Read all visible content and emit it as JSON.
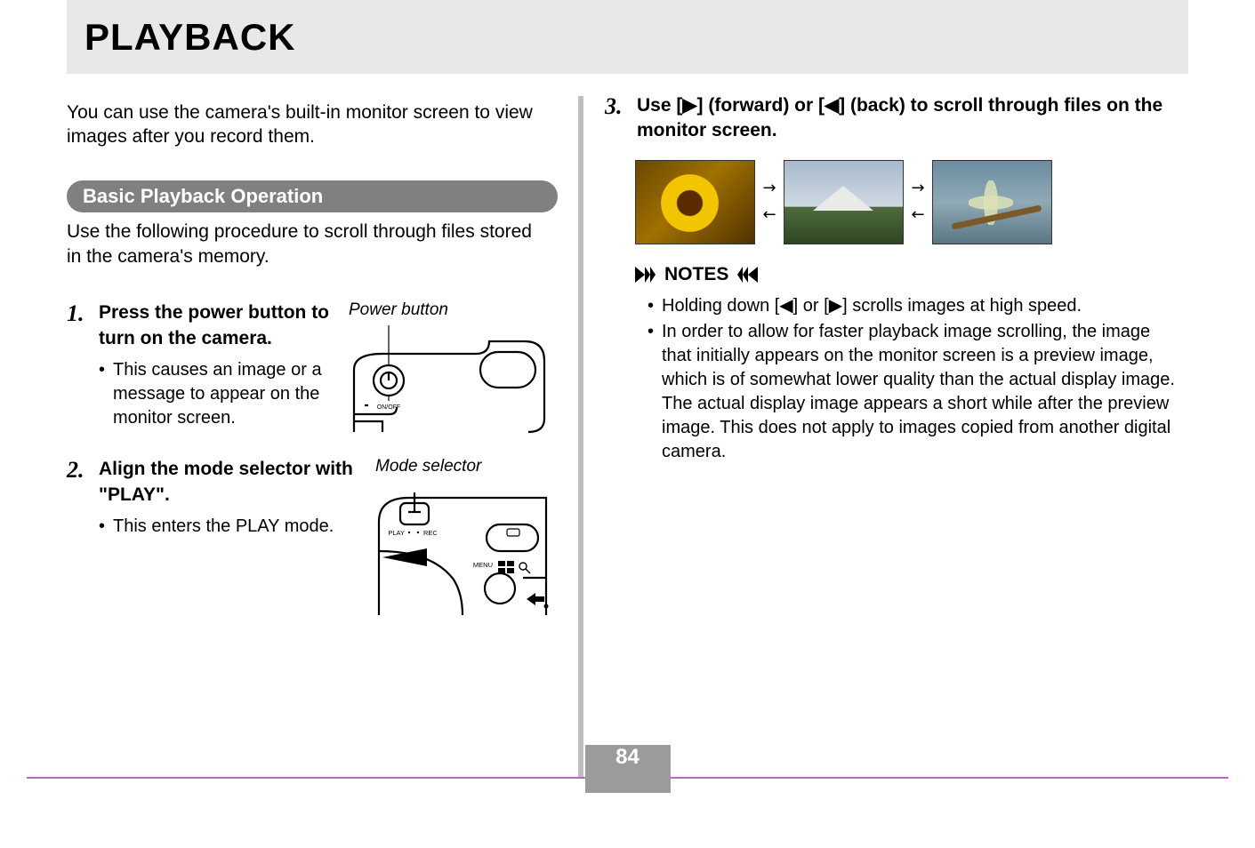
{
  "page": {
    "title": "PLAYBACK",
    "number": "84"
  },
  "intro": "You can use the camera's built-in monitor screen to view images after you record them.",
  "section": {
    "heading": "Basic Playback Operation",
    "description": "Use the following procedure to scroll through files stored in the camera's memory."
  },
  "steps": [
    {
      "num": "1.",
      "title": "Press the power button to turn on the camera.",
      "bullets": [
        "This causes an image or a message to appear on the monitor screen."
      ],
      "figure_label": "Power button",
      "figure_small": "ON/OFF"
    },
    {
      "num": "2.",
      "title": "Align the mode selector with \"PLAY\".",
      "bullets": [
        "This enters the PLAY mode."
      ],
      "figure_label": "Mode selector",
      "figure_small1": "PLAY",
      "figure_small2": "REC",
      "figure_small3": "MENU"
    },
    {
      "num": "3.",
      "title": "Use [▶] (forward) or [◀] (back) to scroll through files on the monitor screen."
    }
  ],
  "notes": {
    "heading": "NOTES",
    "items": [
      "Holding down [◀] or [▶] scrolls images at high speed.",
      "In order to allow for faster playback image scrolling, the image that initially appears on the monitor screen is a preview image, which is of somewhat lower quality than the actual display image. The actual display image appears a short while after the preview image. This does not apply to images copied from another digital camera."
    ]
  },
  "arrows": {
    "right": "→",
    "left": "←"
  }
}
